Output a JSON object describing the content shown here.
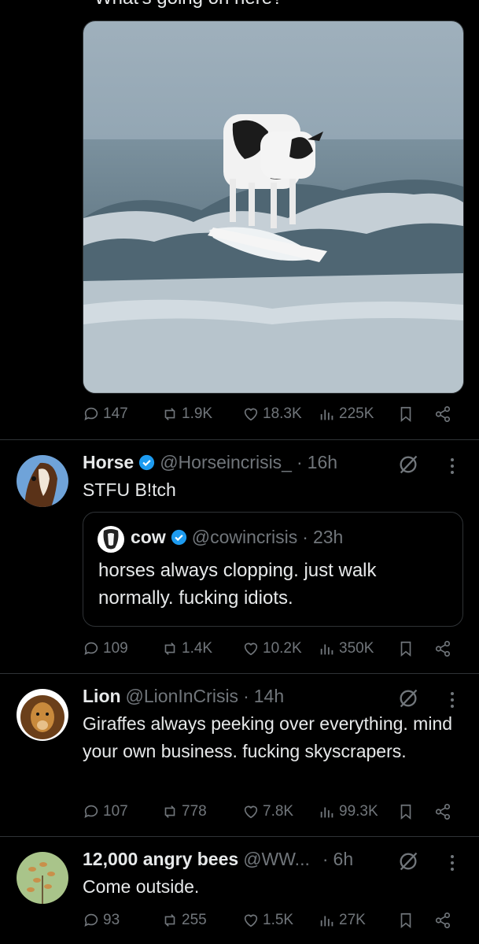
{
  "top_tweet": {
    "partial_text": "What's going on here?",
    "image_alt": "cow surfing on a wave",
    "stats": {
      "replies": "147",
      "reposts": "1.9K",
      "likes": "18.3K",
      "views": "225K"
    }
  },
  "tweets": [
    {
      "name": "Horse",
      "verified": true,
      "handle": "@Horseincrisis_",
      "sep": "·",
      "time": "16h",
      "text": "STFU B!tch",
      "quote": {
        "name": "cow",
        "verified": true,
        "handle": "@cowincrisis",
        "sep": "·",
        "time": "23h",
        "text": "horses always clopping. just walk normally. fucking idiots."
      },
      "stats": {
        "replies": "109",
        "reposts": "1.4K",
        "likes": "10.2K",
        "views": "350K"
      }
    },
    {
      "name": "Lion",
      "verified": false,
      "handle": "@LionInCrisis",
      "sep": "·",
      "time": "14h",
      "text": "Giraffes always peeking over everything. mind your own business. fucking skyscrapers.",
      "stats": {
        "replies": "107",
        "reposts": "778",
        "likes": "7.8K",
        "views": "99.3K"
      }
    },
    {
      "name": "12,000 angry bees",
      "verified": false,
      "handle": "@WW...",
      "sep": "·",
      "time": "6h",
      "text": "Come outside.",
      "stats": {
        "replies": "93",
        "reposts": "255",
        "likes": "1.5K",
        "views": "27K"
      }
    }
  ],
  "colors": {
    "background": "#000000",
    "text": "#e7e9ea",
    "muted": "#71767b",
    "verified": "#1d9bf0",
    "border": "#2f3336"
  }
}
